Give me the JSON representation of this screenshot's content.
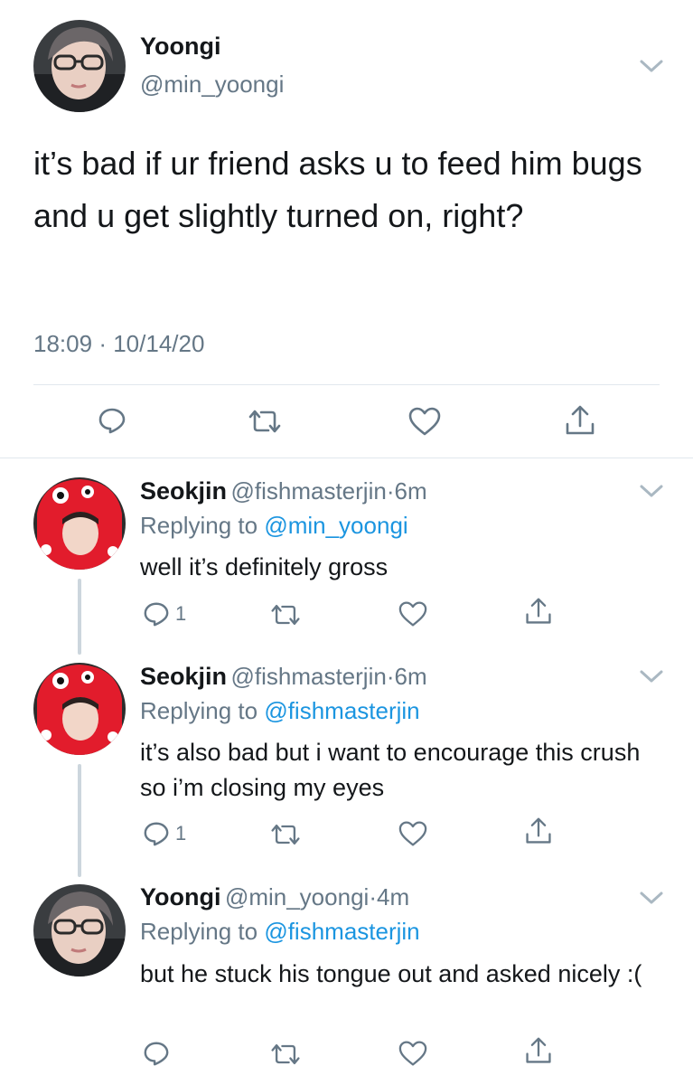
{
  "main_tweet": {
    "author_name": "Yoongi",
    "author_handle": "@min_yoongi",
    "text": "it’s bad if ur friend asks u to feed him bugs and u get slightly turned on, right?",
    "time": "18:09",
    "separator": "·",
    "date": "10/14/20",
    "actions": [
      "reply-icon",
      "retweet-icon",
      "like-icon",
      "share-icon"
    ]
  },
  "replies": [
    {
      "author_name": "Seokjin",
      "author_handle": "@fishmasterjin",
      "separator": "·",
      "time_ago": "6m",
      "replying_prefix": "Replying to",
      "replying_to": "@min_yoongi",
      "text": "well it’s definitely gross",
      "reply_count": "1"
    },
    {
      "author_name": "Seokjin",
      "author_handle": "@fishmasterjin",
      "separator": "·",
      "time_ago": "6m",
      "replying_prefix": "Replying to",
      "replying_to": "@fishmasterjin",
      "text": "it’s also bad but i want to encourage this crush so i’m closing my eyes",
      "reply_count": "1"
    },
    {
      "author_name": "Yoongi",
      "author_handle": "@min_yoongi",
      "separator": "·",
      "time_ago": "4m",
      "replying_prefix": "Replying to",
      "replying_to": "@fishmasterjin",
      "text": "but he stuck his tongue out and asked nicely :(",
      "reply_count": ""
    }
  ],
  "colors": {
    "text": "#14171a",
    "secondary": "#657786",
    "link": "#1b95e0",
    "divider": "#e1e8ed",
    "thread_line": "#ccd6dd"
  }
}
